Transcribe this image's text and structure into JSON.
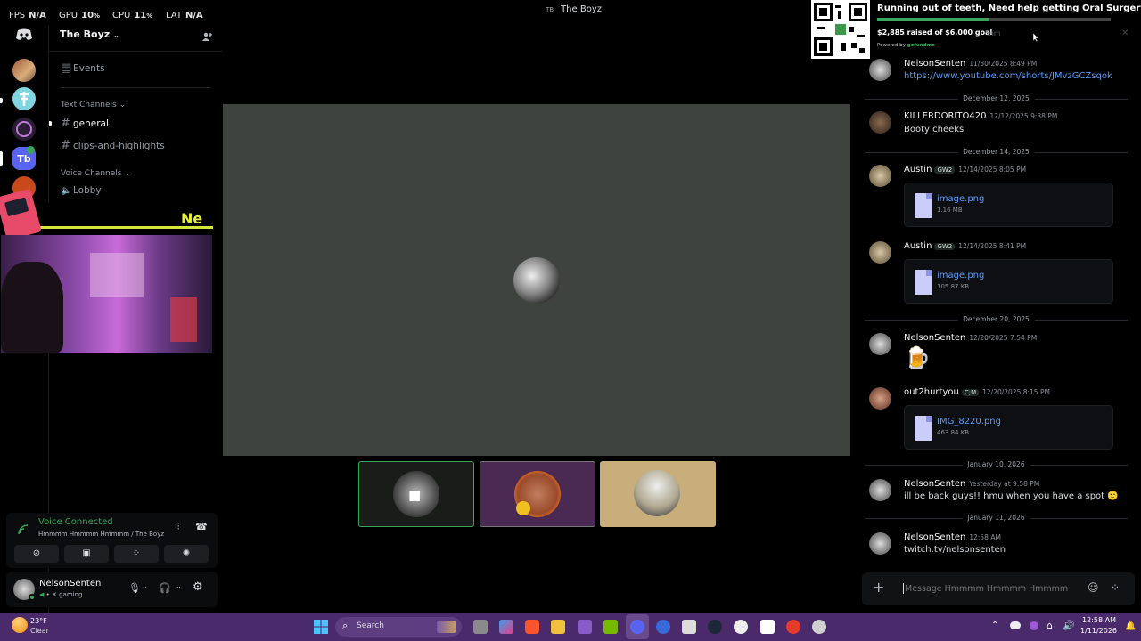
{
  "topbar": {
    "fps_label": "FPS",
    "fps_value": "N/A",
    "gpu_label": "GPU",
    "gpu_value": "10",
    "cpu_label": "CPU",
    "cpu_value": "11",
    "lat_label": "LAT",
    "lat_value": "N/A",
    "percent": "%",
    "window_badge": "TB",
    "window_title": "The Boyz"
  },
  "fundraiser": {
    "title": "Running out of teeth, Need help getting Oral Surgery!",
    "raised": "$2,885 raised of $6,000 goal",
    "progress": 0.48,
    "powered": "Powered by",
    "brand": "gofundme",
    "behind_text": "mm"
  },
  "server": {
    "name": "The Boyz",
    "events": "Events",
    "text_channels": "Text Channels",
    "channels": [
      "general",
      "clips-and-highlights"
    ],
    "voice_channels": "Voice Channels",
    "voice": [
      "Lobby"
    ],
    "overlay_text": "Ne"
  },
  "voice_panel": {
    "status": "Voice Connected",
    "location": "Hmmmm Hmmmm Hmmmm / The Boyz"
  },
  "user": {
    "name": "NelsonSenten",
    "status": "gaming"
  },
  "chat": {
    "messages": [
      {
        "author": "NelsonSenten",
        "time": "11/30/2025 8:49 PM",
        "text": "https://www.youtube.com/shorts/JMvzGCZsqok"
      },
      {
        "author": "KILLERDORITO420",
        "time": "12/12/2025 9:38 PM",
        "text": "Booty cheeks"
      },
      {
        "author": "Austin",
        "tag": "GW2",
        "time": "12/14/2025 8:05 PM",
        "file": "image.png",
        "size": "1.16 MB"
      },
      {
        "author": "Austin",
        "tag": "GW2",
        "time": "12/14/2025 8:41 PM",
        "file": "image.png",
        "size": "105.87 KB"
      },
      {
        "author": "NelsonSenten",
        "time": "12/20/2025 7:54 PM",
        "emoji": "🍺"
      },
      {
        "author": "out2hurtyou",
        "tag": "C;M",
        "time": "12/20/2025 8:15 PM",
        "file": "IMG_8220.png",
        "size": "463.84 KB"
      },
      {
        "author": "NelsonSenten",
        "time": "Yesterday at 9:58 PM",
        "text": "ill be back guys!! hmu when you have a spot",
        "emoji": "🙂"
      },
      {
        "author": "NelsonSenten",
        "time": "12:58 AM",
        "text": "twitch.tv/nelsonsenten"
      }
    ],
    "dividers": [
      "December 12, 2025",
      "December 14, 2025",
      "December 20, 2025",
      "January 10, 2026",
      "January 11, 2026"
    ],
    "composer_placeholder": "Message Hmmmm Hmmmm Hmmmm"
  },
  "taskbar": {
    "weather_temp": "23°F",
    "weather_cond": "Clear",
    "search": "Search",
    "time": "12:58 AM",
    "date": "1/11/2026"
  },
  "colors": {
    "voice_green": "#3ba55c",
    "link_blue": "#5b9cf5",
    "taskbar_purple": "#4a2a6b",
    "stage_grey": "#3f4340",
    "tile_tan": "#c8ae7a"
  }
}
